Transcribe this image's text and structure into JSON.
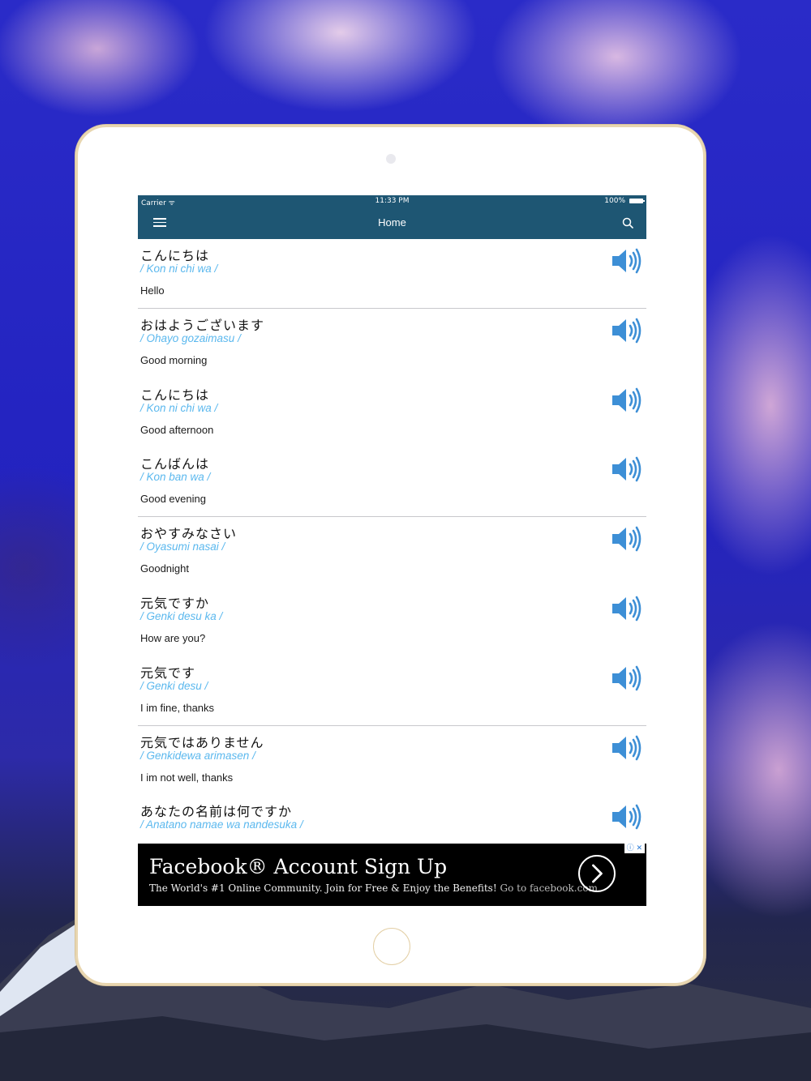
{
  "status_bar": {
    "carrier": "Carrier ᯤ",
    "time": "11:33 PM",
    "battery": "100%"
  },
  "nav": {
    "title": "Home",
    "menu_icon": "hamburger-menu-icon",
    "search_icon": "search-icon"
  },
  "phrases": [
    {
      "japanese": "こんにちは",
      "romaji": "/ Kon ni chi wa /",
      "english": "Hello"
    },
    {
      "japanese": "おはようございます",
      "romaji": "/ Ohayo gozaimasu /",
      "english": "Good morning"
    },
    {
      "japanese": "こんにちは",
      "romaji": "/ Kon ni chi wa /",
      "english": "Good afternoon"
    },
    {
      "japanese": "こんばんは",
      "romaji": "/ Kon ban wa /",
      "english": "Good evening"
    },
    {
      "japanese": "おやすみなさい",
      "romaji": "/ Oyasumi nasai /",
      "english": "Goodnight"
    },
    {
      "japanese": "元気ですか",
      "romaji": "/ Genki desu ka /",
      "english": "How are you?"
    },
    {
      "japanese": "元気です",
      "romaji": "/ Genki desu /",
      "english": "I im fine, thanks"
    },
    {
      "japanese": "元気ではありません",
      "romaji": "/ Genkidewa arimasen /",
      "english": "I im not well, thanks"
    },
    {
      "japanese": "あなたの名前は何ですか",
      "romaji": "/ Anatano namae wa nandesuka /",
      "english": ""
    }
  ],
  "ad": {
    "title": "Facebook® Account Sign Up",
    "subtitle": "The World's #1 Online Community. Join for Free & Enjoy the Benefits!",
    "link": "Go to facebook.com",
    "badge": "ⓘ ✕"
  },
  "colors": {
    "nav_bar": "#1e5673",
    "romaji": "#5bb8ee",
    "speaker": "#3d8fd6",
    "device_frame": "#ffffff",
    "device_border": "#e8d6b0"
  }
}
